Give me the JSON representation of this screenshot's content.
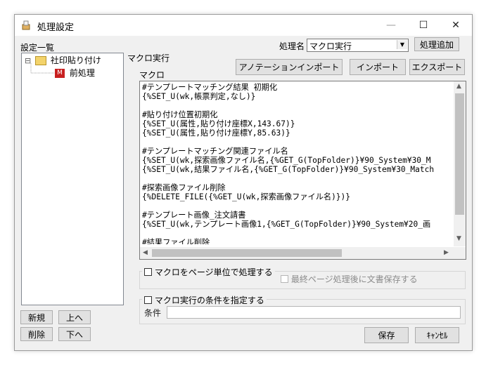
{
  "window": {
    "title": "処理設定",
    "minimize_glyph": "—",
    "maximize_glyph": "☐",
    "close_glyph": "✕"
  },
  "left_panel": {
    "header": "設定一覧",
    "tree": [
      {
        "label": "社印貼り付け",
        "expander": "⊟"
      },
      {
        "label": "前処理"
      }
    ],
    "buttons": {
      "new": "新規",
      "up": "上へ",
      "delete": "削除",
      "down": "下へ"
    }
  },
  "process_name": {
    "label": "処理名",
    "value": "マクロ実行",
    "add_button": "処理追加"
  },
  "macro": {
    "section_label": "マクロ実行",
    "field_label": "マクロ",
    "buttons": {
      "annotation_import": "アノテーションインポート",
      "import": "インポート",
      "export": "エクスポート"
    },
    "code_lines": [
      "#テンプレートマッチング結果 初期化",
      "{%SET_U(wk,帳票判定,なし)}",
      "",
      "#貼り付け位置初期化",
      "{%SET_U(属性,貼り付け座標X,143.67)}",
      "{%SET_U(属性,貼り付け座標Y,85.63)}",
      "",
      "#テンプレートマッチング関連ファイル名",
      "{%SET_U(wk,探索画像ファイル名,{%GET_G(TopFolder)}¥90_System¥30_M",
      "{%SET_U(wk,結果ファイル名,{%GET_G(TopFolder)}¥90_System¥30_Match",
      "",
      "#探索画像ファイル削除",
      "{%DELETE_FILE({%GET_U(wk,探索画像ファイル名)})}",
      "",
      "#テンプレート画像_注文請書",
      "{%SET_U(wk,テンプレート画像1,{%GET_G(TopFolder)}¥90_System¥20_画",
      "",
      "#結果ファイル削除"
    ]
  },
  "options": {
    "per_page": "マクロをページ単位で処理する",
    "save_after_last_page": "最終ページ処理後に文書保存する",
    "condition_check": "マクロ実行の条件を指定する",
    "condition_label": "条件"
  },
  "footer": {
    "save": "保存",
    "cancel": "ｷｬﾝｾﾙ"
  }
}
